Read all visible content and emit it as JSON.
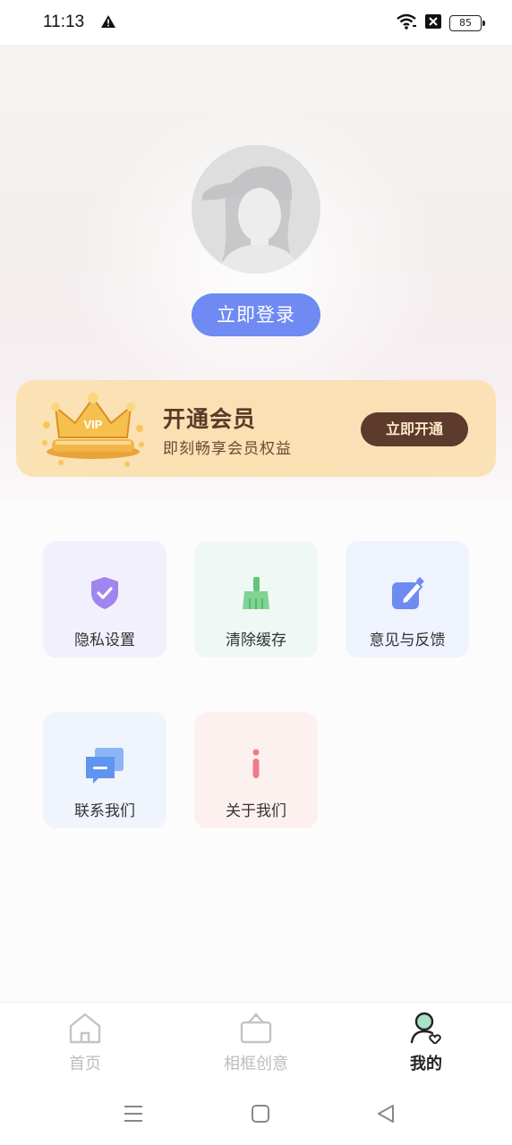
{
  "status_bar": {
    "time": "11:13",
    "battery": "85",
    "icons": [
      "warning-icon",
      "wifi-icon",
      "no-sim-icon",
      "battery-icon"
    ]
  },
  "profile": {
    "login_label": "立即登录"
  },
  "vip": {
    "badge": "VIP",
    "title": "开通会员",
    "subtitle": "即刻畅享会员权益",
    "button_label": "立即开通"
  },
  "tiles": [
    {
      "label": "隐私设置",
      "icon": "shield-check-icon",
      "bg": "#f3f0fd"
    },
    {
      "label": "清除缓存",
      "icon": "broom-icon",
      "bg": "#eff8f4"
    },
    {
      "label": "意见与反馈",
      "icon": "edit-icon",
      "bg": "#eff3fd"
    },
    {
      "label": "联系我们",
      "icon": "chat-icon",
      "bg": "#eff4fd"
    },
    {
      "label": "关于我们",
      "icon": "info-icon",
      "bg": "#fdf1ef"
    }
  ],
  "nav": {
    "items": [
      {
        "label": "首页",
        "icon": "home-icon",
        "active": false
      },
      {
        "label": "相框创意",
        "icon": "frame-icon",
        "active": false
      },
      {
        "label": "我的",
        "icon": "profile-icon",
        "active": true
      }
    ]
  },
  "colors": {
    "accent": "#6f8af2",
    "vip_bg": "#fbe2b4",
    "vip_button": "#5c3a2c"
  }
}
